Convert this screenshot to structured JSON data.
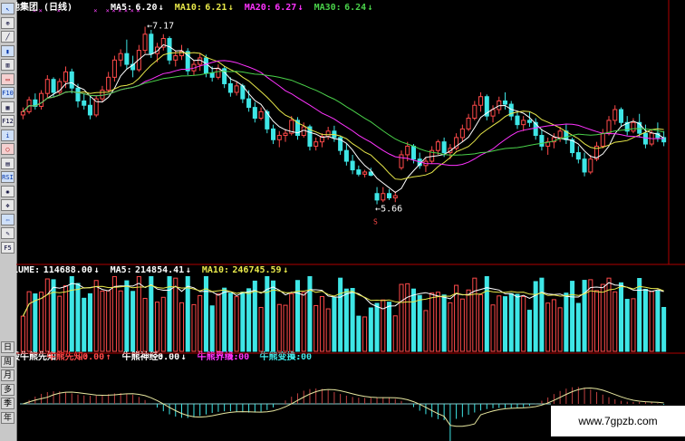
{
  "toolbar": {
    "icons": [
      {
        "name": "cursor-icon",
        "glyph": "↖"
      },
      {
        "name": "zoom-icon",
        "glyph": "⊕"
      },
      {
        "name": "line-chart-icon",
        "glyph": "╱"
      },
      {
        "name": "kline-icon",
        "glyph": "▮"
      },
      {
        "name": "bar-icon",
        "glyph": "▥"
      },
      {
        "name": "window-icon",
        "glyph": "▭"
      },
      {
        "name": "f10-icon",
        "glyph": "F10"
      },
      {
        "name": "grid-icon",
        "glyph": "▦"
      },
      {
        "name": "f12-icon",
        "glyph": "F12"
      },
      {
        "name": "info-icon",
        "glyph": "i"
      },
      {
        "name": "search-icon",
        "glyph": "○"
      },
      {
        "name": "table-icon",
        "glyph": "▤"
      },
      {
        "name": "rsi-icon",
        "glyph": "RSI"
      },
      {
        "name": "gear-icon",
        "glyph": "✺"
      },
      {
        "name": "move-icon",
        "glyph": "✥"
      },
      {
        "name": "exit-icon",
        "glyph": "⇦"
      },
      {
        "name": "pencil-icon",
        "glyph": "✎"
      },
      {
        "name": "f5-icon",
        "glyph": "F5"
      }
    ],
    "periods": [
      "日",
      "周",
      "月",
      "多",
      "季",
      "年"
    ]
  },
  "colors": {
    "up": "#ff4a4a",
    "down": "#3ee6e6",
    "ma5": "#ffffff",
    "ma10": "#e8e84a",
    "ma20": "#ff33ff",
    "ma30": "#4ad24a",
    "axis": "#b00000",
    "text": "#ffffff"
  },
  "chart_data": [
    {
      "type": "candlestick",
      "title": "金地集团 (日线)",
      "legend": [
        {
          "label": "MA5:",
          "value": "6.20",
          "arrow": "↓",
          "color": "#ffffff"
        },
        {
          "label": "MA10:",
          "value": "6.21",
          "arrow": "↓",
          "color": "#e8e84a"
        },
        {
          "label": "MA20:",
          "value": "6.27",
          "arrow": "↓",
          "color": "#ff33ff"
        },
        {
          "label": "MA30:",
          "value": "6.24",
          "arrow": "↓",
          "color": "#4ad24a"
        }
      ],
      "annotations": [
        {
          "text": "7.17",
          "type": "high"
        },
        {
          "text": "5.66",
          "type": "low"
        }
      ],
      "marks_top": "×",
      "marks_bottom": "S",
      "ylim": [
        5.5,
        7.3
      ],
      "ohlc": [
        [
          6.35,
          6.42,
          6.31,
          6.38
        ],
        [
          6.38,
          6.52,
          6.36,
          6.49
        ],
        [
          6.49,
          6.55,
          6.4,
          6.43
        ],
        [
          6.43,
          6.58,
          6.4,
          6.55
        ],
        [
          6.55,
          6.72,
          6.5,
          6.68
        ],
        [
          6.68,
          6.7,
          6.52,
          6.56
        ],
        [
          6.56,
          6.69,
          6.53,
          6.66
        ],
        [
          6.66,
          6.8,
          6.6,
          6.75
        ],
        [
          6.75,
          6.78,
          6.55,
          6.6
        ],
        [
          6.6,
          6.64,
          6.42,
          6.48
        ],
        [
          6.48,
          6.55,
          6.4,
          6.44
        ],
        [
          6.44,
          6.52,
          6.31,
          6.35
        ],
        [
          6.35,
          6.53,
          6.33,
          6.5
        ],
        [
          6.5,
          6.62,
          6.47,
          6.58
        ],
        [
          6.58,
          6.75,
          6.56,
          6.7
        ],
        [
          6.7,
          6.9,
          6.66,
          6.86
        ],
        [
          6.86,
          6.96,
          6.8,
          6.92
        ],
        [
          6.92,
          7.05,
          6.78,
          6.82
        ],
        [
          6.82,
          6.9,
          6.7,
          6.77
        ],
        [
          6.77,
          7.0,
          6.75,
          6.95
        ],
        [
          6.95,
          7.17,
          6.92,
          7.1
        ],
        [
          7.1,
          7.14,
          6.88,
          6.92
        ],
        [
          6.92,
          7.02,
          6.84,
          6.98
        ],
        [
          6.98,
          7.1,
          6.95,
          7.06
        ],
        [
          7.06,
          7.08,
          6.82,
          6.86
        ],
        [
          6.86,
          6.95,
          6.8,
          6.9
        ],
        [
          6.9,
          7.0,
          6.86,
          6.94
        ],
        [
          6.94,
          6.97,
          6.72,
          6.76
        ],
        [
          6.76,
          6.86,
          6.72,
          6.82
        ],
        [
          6.82,
          6.92,
          6.76,
          6.88
        ],
        [
          6.88,
          6.91,
          6.7,
          6.74
        ],
        [
          6.74,
          6.8,
          6.66,
          6.7
        ],
        [
          6.7,
          6.82,
          6.68,
          6.78
        ],
        [
          6.78,
          6.8,
          6.6,
          6.64
        ],
        [
          6.64,
          6.7,
          6.52,
          6.56
        ],
        [
          6.56,
          6.66,
          6.53,
          6.62
        ],
        [
          6.62,
          6.64,
          6.46,
          6.5
        ],
        [
          6.5,
          6.58,
          6.38,
          6.42
        ],
        [
          6.42,
          6.47,
          6.28,
          6.32
        ],
        [
          6.32,
          6.42,
          6.3,
          6.38
        ],
        [
          6.38,
          6.4,
          6.18,
          6.22
        ],
        [
          6.22,
          6.26,
          6.08,
          6.12
        ],
        [
          6.12,
          6.2,
          6.05,
          6.16
        ],
        [
          6.16,
          6.22,
          6.1,
          6.18
        ],
        [
          6.18,
          6.34,
          6.16,
          6.3
        ],
        [
          6.3,
          6.33,
          6.12,
          6.16
        ],
        [
          6.16,
          6.28,
          6.14,
          6.24
        ],
        [
          6.24,
          6.26,
          6.02,
          6.06
        ],
        [
          6.06,
          6.14,
          6.02,
          6.1
        ],
        [
          6.1,
          6.18,
          6.05,
          6.15
        ],
        [
          6.15,
          6.24,
          6.12,
          6.2
        ],
        [
          6.2,
          6.25,
          6.1,
          6.14
        ],
        [
          6.14,
          6.16,
          5.98,
          6.02
        ],
        [
          6.02,
          6.08,
          5.88,
          5.92
        ],
        [
          5.92,
          5.98,
          5.8,
          5.84
        ],
        [
          5.84,
          5.88,
          5.78,
          5.8
        ],
        [
          5.8,
          5.84,
          5.77,
          5.82
        ],
        [
          5.82,
          5.86,
          5.78,
          5.79
        ],
        [
          5.62,
          5.68,
          5.52,
          5.56
        ],
        [
          5.56,
          5.68,
          5.54,
          5.62
        ],
        [
          5.62,
          5.66,
          5.56,
          5.58
        ],
        [
          5.58,
          5.64,
          5.54,
          5.6
        ],
        [
          5.86,
          6.02,
          5.84,
          5.98
        ],
        [
          5.98,
          6.1,
          5.92,
          6.06
        ],
        [
          6.06,
          6.08,
          5.9,
          5.94
        ],
        [
          5.94,
          6.0,
          5.85,
          5.88
        ],
        [
          5.88,
          5.96,
          5.82,
          5.92
        ],
        [
          5.92,
          6.06,
          5.9,
          6.02
        ],
        [
          6.02,
          6.12,
          5.98,
          6.1
        ],
        [
          6.1,
          6.14,
          5.96,
          6.0
        ],
        [
          6.0,
          6.08,
          5.94,
          6.04
        ],
        [
          6.04,
          6.18,
          6.02,
          6.14
        ],
        [
          6.14,
          6.26,
          6.1,
          6.22
        ],
        [
          6.22,
          6.36,
          6.2,
          6.32
        ],
        [
          6.32,
          6.48,
          6.3,
          6.44
        ],
        [
          6.44,
          6.56,
          6.38,
          6.52
        ],
        [
          6.52,
          6.54,
          6.3,
          6.34
        ],
        [
          6.34,
          6.44,
          6.28,
          6.4
        ],
        [
          6.4,
          6.52,
          6.36,
          6.48
        ],
        [
          6.48,
          6.56,
          6.4,
          6.45
        ],
        [
          6.45,
          6.48,
          6.3,
          6.34
        ],
        [
          6.34,
          6.38,
          6.22,
          6.26
        ],
        [
          6.26,
          6.34,
          6.2,
          6.3
        ],
        [
          6.3,
          6.38,
          6.24,
          6.28
        ],
        [
          6.28,
          6.32,
          6.12,
          6.16
        ],
        [
          6.16,
          6.22,
          6.02,
          6.06
        ],
        [
          6.06,
          6.14,
          5.98,
          6.1
        ],
        [
          6.1,
          6.18,
          6.04,
          6.14
        ],
        [
          6.14,
          6.24,
          6.1,
          6.2
        ],
        [
          6.2,
          6.26,
          6.08,
          6.12
        ],
        [
          6.12,
          6.14,
          5.96,
          6.0
        ],
        [
          6.0,
          6.06,
          5.9,
          5.94
        ],
        [
          5.94,
          6.0,
          5.78,
          5.82
        ],
        [
          5.82,
          5.98,
          5.8,
          5.94
        ],
        [
          5.94,
          6.1,
          5.92,
          6.06
        ],
        [
          6.06,
          6.22,
          6.04,
          6.18
        ],
        [
          6.18,
          6.34,
          6.16,
          6.3
        ],
        [
          6.3,
          6.44,
          6.26,
          6.4
        ],
        [
          6.4,
          6.42,
          6.24,
          6.28
        ],
        [
          6.28,
          6.34,
          6.16,
          6.2
        ],
        [
          6.2,
          6.32,
          6.18,
          6.28
        ],
        [
          6.28,
          6.36,
          6.14,
          6.18
        ],
        [
          6.18,
          6.26,
          6.04,
          6.08
        ],
        [
          6.08,
          6.22,
          6.06,
          6.18
        ],
        [
          6.18,
          6.28,
          6.1,
          6.14
        ],
        [
          6.14,
          6.2,
          6.06,
          6.1
        ]
      ]
    },
    {
      "type": "bar",
      "title": "VOLUME",
      "legend": [
        {
          "label": "VOLUME:",
          "value": "114688.00",
          "arrow": "↓",
          "color": "#ffffff"
        },
        {
          "label": "MA5:",
          "value": "214854.41",
          "arrow": "↓",
          "color": "#ffffff"
        },
        {
          "label": "MA10:",
          "value": "246745.59",
          "arrow": "↓",
          "color": "#e8e84a"
        }
      ],
      "y_ticks": [
        "5",
        "45",
        "30",
        "15"
      ],
      "ylim": [
        0,
        50
      ],
      "unit_label": "N"
    },
    {
      "type": "histogram",
      "title": "个股牛熊先知",
      "legend": [
        {
          "label": "个股牛熊先知",
          "value": "",
          "arrow": "",
          "color": "#ffffff"
        },
        {
          "label": "牛熊先知:",
          "value": "-0.00",
          "arrow": "↑",
          "color": "#ff4a4a"
        },
        {
          "label": "牛熊神经:",
          "value": "-0.00",
          "arrow": "↓",
          "color": "#ffffff"
        },
        {
          "label": "牛熊界线:",
          "value": "0.00",
          "arrow": "",
          "color": "#ff33ff"
        },
        {
          "label": "牛熊变换:",
          "value": "0.00",
          "arrow": "",
          "color": "#3ee6e6"
        }
      ]
    }
  ],
  "watermark": "www.7gpzb.com"
}
